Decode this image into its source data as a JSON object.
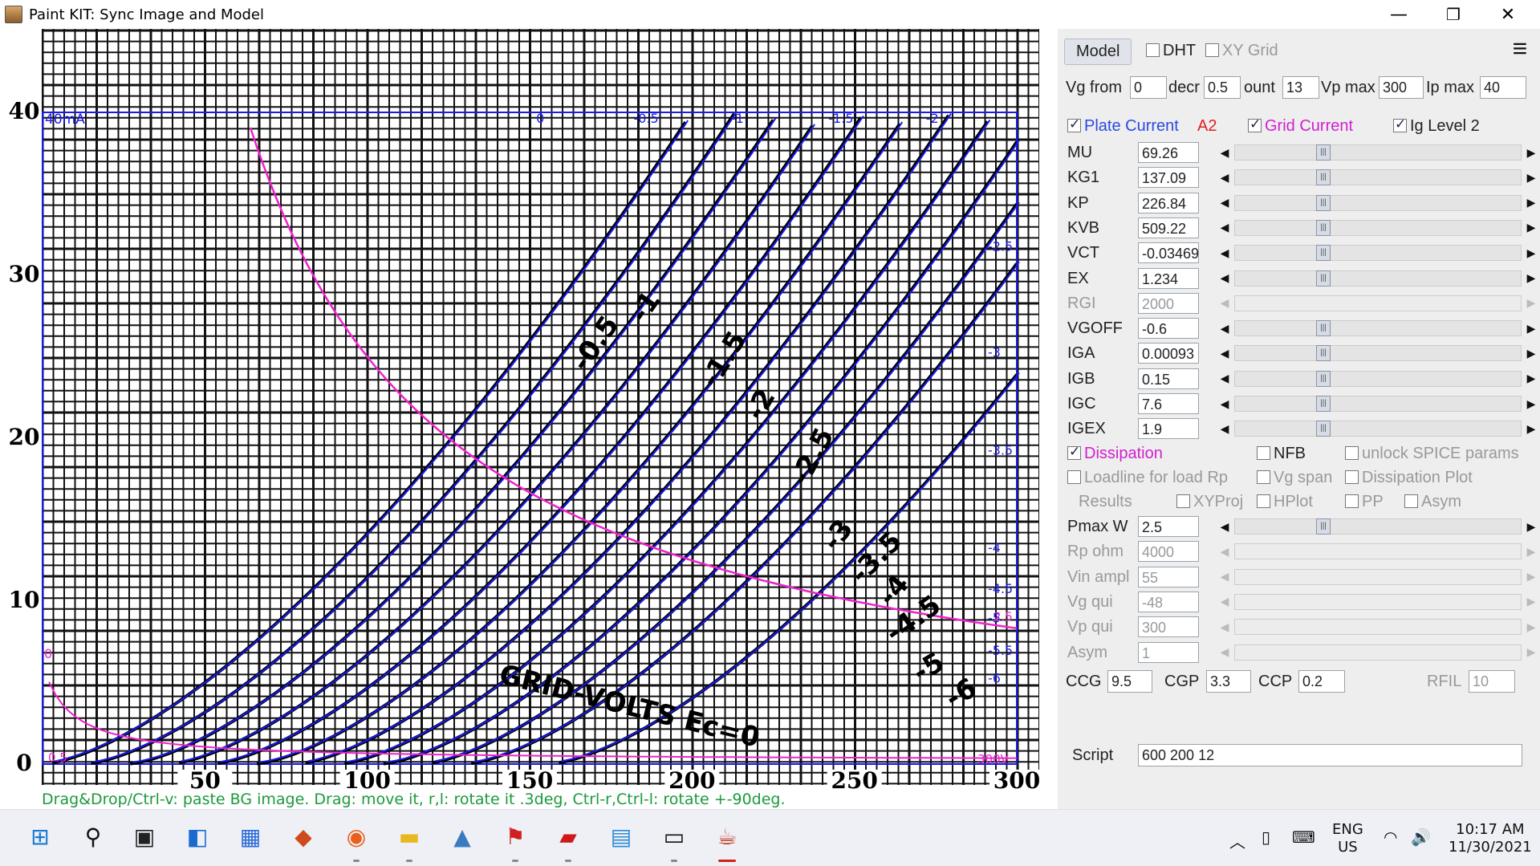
{
  "window": {
    "title": "Paint KIT: Sync Image and Model",
    "minimize": "—",
    "restore": "❐",
    "close": "✕"
  },
  "chart": {
    "y_ticks": [
      "0",
      "10",
      "20",
      "30",
      "40"
    ],
    "x_ticks": [
      "50",
      "100",
      "150",
      "200",
      "250",
      "300"
    ],
    "scan_curve_labels": [
      "GRID-VOLTS Ec=0",
      "-0.5",
      "-1",
      "-1.5",
      "-2",
      "-2.5",
      "-3",
      "-3.5",
      "-4",
      "-4.5",
      "-5",
      "-6"
    ],
    "model_top_labels": [
      "0",
      "-0.5",
      "-1",
      "-1.5",
      "-2"
    ],
    "model_side_labels": [
      "-2.5",
      "-3",
      "-3.5",
      "-4",
      "-4.5",
      "-5",
      "-5.5",
      "-6"
    ],
    "corner_label": "40mA",
    "vp_label": "300V",
    "zero_label": "0",
    "zero_label2": "0.5",
    "dissipation_label": "2.5"
  },
  "hint": "Drag&Drop/Ctrl-v: paste BG image. Drag: move it, r,l: rotate it .3deg, Ctrl-r,Ctrl-l: rotate +-90deg.",
  "panel": {
    "model_button": "Model",
    "dht": {
      "label": "DHT",
      "checked": false
    },
    "xy_grid": {
      "label": "XY Grid",
      "checked": false
    },
    "menu_icon": "≡",
    "vg_from": {
      "label": "Vg from",
      "value": "0"
    },
    "decr": {
      "label": "decr",
      "value": "0.5"
    },
    "count": {
      "label": "ount",
      "value": "13"
    },
    "vp_max": {
      "label": "Vp max",
      "value": "300"
    },
    "ip_max": {
      "label": "Ip max",
      "value": "40"
    },
    "plate_current": {
      "label": "Plate Current",
      "checked": true
    },
    "tube_name": "A2",
    "grid_current": {
      "label": "Grid Current",
      "checked": true
    },
    "ig_level2": {
      "label": "Ig Level 2",
      "checked": true
    },
    "params": [
      {
        "name": "MU",
        "value": "69.26",
        "enabled": true,
        "pos": 0.3
      },
      {
        "name": "KG1",
        "value": "137.09",
        "enabled": true,
        "pos": 0.3
      },
      {
        "name": "KP",
        "value": "226.84",
        "enabled": true,
        "pos": 0.3
      },
      {
        "name": "KVB",
        "value": "509.22",
        "enabled": true,
        "pos": 0.3
      },
      {
        "name": "VCT",
        "value": "-0.03469",
        "enabled": true,
        "pos": 0.3
      },
      {
        "name": "EX",
        "value": "1.234",
        "enabled": true,
        "pos": 0.3
      },
      {
        "name": "RGI",
        "value": "2000",
        "enabled": false,
        "pos": null
      },
      {
        "name": "VGOFF",
        "value": "-0.6",
        "enabled": true,
        "pos": 0.3
      },
      {
        "name": "IGA",
        "value": "0.00093",
        "enabled": true,
        "pos": 0.3
      },
      {
        "name": "IGB",
        "value": "0.15",
        "enabled": true,
        "pos": 0.3
      },
      {
        "name": "IGC",
        "value": "7.6",
        "enabled": true,
        "pos": 0.3
      },
      {
        "name": "IGEX",
        "value": "1.9",
        "enabled": true,
        "pos": 0.3
      }
    ],
    "dissipation": {
      "label": "Dissipation",
      "checked": true
    },
    "nfb": {
      "label": "NFB",
      "checked": false
    },
    "unlock_spice": {
      "label": "unlock SPICE params",
      "checked": false
    },
    "loadline": {
      "label": "Loadline for load Rp",
      "checked": false
    },
    "vg_span": {
      "label": "Vg span",
      "checked": false
    },
    "dissipation_plot": {
      "label": "Dissipation Plot",
      "checked": false
    },
    "results_label": "Results",
    "xyproj": {
      "label": "XYProj",
      "checked": false
    },
    "hplot": {
      "label": "HPlot",
      "checked": false
    },
    "pp": {
      "label": "PP",
      "checked": false
    },
    "asym_chk": {
      "label": "Asym",
      "checked": false
    },
    "load_params": [
      {
        "name": "Pmax W",
        "value": "2.5",
        "enabled": true,
        "pos": 0.3
      },
      {
        "name": "Rp ohm",
        "value": "4000",
        "enabled": false,
        "pos": null
      },
      {
        "name": "Vin ampl",
        "value": "55",
        "enabled": false,
        "pos": null
      },
      {
        "name": "Vg qui",
        "value": "-48",
        "enabled": false,
        "pos": null
      },
      {
        "name": "Vp qui",
        "value": "300",
        "enabled": false,
        "pos": null
      },
      {
        "name": "Asym",
        "value": "1",
        "enabled": false,
        "pos": null
      }
    ],
    "ccg": {
      "label": "CCG",
      "value": "9.5"
    },
    "cgp": {
      "label": "CGP",
      "value": "3.3"
    },
    "ccp": {
      "label": "CCP",
      "value": "0.2"
    },
    "rfil": {
      "label": "RFIL",
      "value": "10"
    },
    "script": {
      "label": "Script",
      "value": "600 200 12"
    }
  },
  "taskbar": {
    "lang_top": "ENG",
    "lang_bottom": "US",
    "time": "10:17 AM",
    "date": "11/30/2021",
    "icons": [
      "windows-start-icon",
      "search-icon",
      "task-view-icon",
      "widgets-icon",
      "store-icon",
      "office-icon",
      "firefox-icon",
      "file-explorer-icon",
      "app-triangle-icon",
      "app-flag-icon",
      "acrobat-icon",
      "notepad-icon",
      "terminal-icon",
      "java-icon"
    ]
  },
  "colors": {
    "model_line": "#1a1aee",
    "scan_line": "#000000",
    "dissipation": "#ee22cc",
    "hint": "#1a9a3a",
    "red_label": "#e02020",
    "magenta_label": "#d020d0"
  }
}
